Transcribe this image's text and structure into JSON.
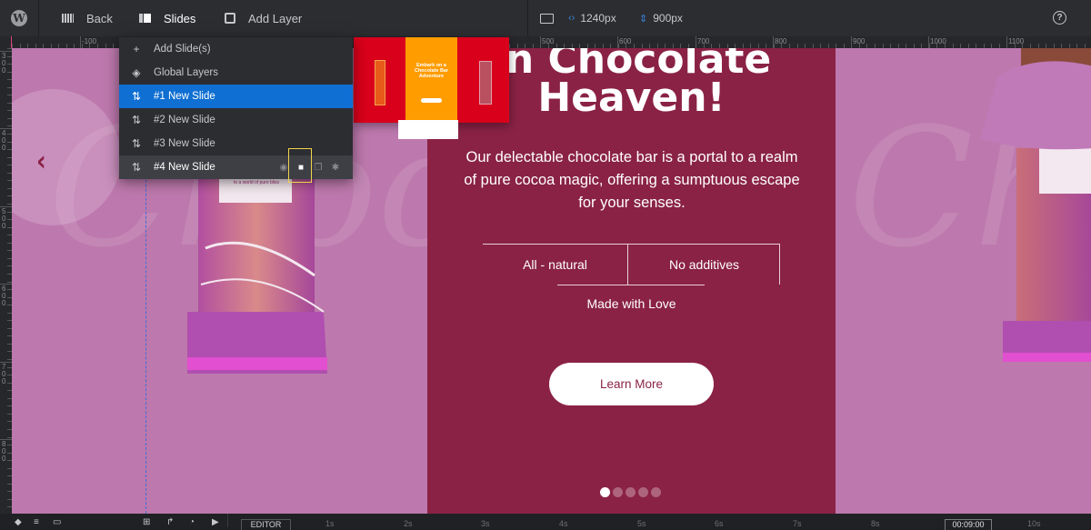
{
  "topbar": {
    "wp_icon": "wordpress-logo-icon",
    "back_label": "Back",
    "slides_label": "Slides",
    "add_layer_label": "Add Layer",
    "device_icon": "desktop-monitor-icon",
    "width_value": "1240px",
    "height_value": "900px",
    "help_icon": "help-circle-icon",
    "help_glyph": "?"
  },
  "rulers": {
    "horizontal_labels": [
      "-100",
      "500",
      "600",
      "700",
      "800",
      "900",
      "1000",
      "1100"
    ],
    "vertical_labels": [
      "300",
      "400",
      "500",
      "600",
      "700",
      "800"
    ]
  },
  "slides_menu": {
    "items": [
      {
        "label": "Add Slide(s)",
        "icon": "plus-icon",
        "glyph": "+"
      },
      {
        "label": "Global Layers",
        "icon": "layers-icon",
        "glyph": "◈"
      },
      {
        "label": "#1 New Slide",
        "icon": "sort-arrows-icon",
        "glyph": "⇅",
        "state": "selected"
      },
      {
        "label": "#2 New Slide",
        "icon": "sort-arrows-icon",
        "glyph": "⇅"
      },
      {
        "label": "#3 New Slide",
        "icon": "sort-arrows-icon",
        "glyph": "⇅"
      },
      {
        "label": "#4 New Slide",
        "icon": "sort-arrows-icon",
        "glyph": "⇅",
        "state": "hover"
      }
    ],
    "row_actions": {
      "visibility_glyph": "◉",
      "delete_glyph": "■",
      "duplicate_glyph": "❐",
      "settings_glyph": "✱"
    }
  },
  "preview": {
    "title": "Embark on a Chocolate Bar Adventure"
  },
  "slide": {
    "headline_line1": "in Chocolate",
    "headline_line2": "Heaven!",
    "paragraph": "Our delectable chocolate bar is a portal to a realm of pure cocoa magic, offering a sumptuous escape for your senses.",
    "feature_1": "All - natural",
    "feature_2": "No additives",
    "feature_3": "Made with Love",
    "cta_label": "Learn More",
    "prev_arrow": "‹",
    "script_text": "Choco",
    "dots_total": 5,
    "dots_active_index": 0,
    "wrapper_text": "to a world of pure bliss"
  },
  "bottombar": {
    "editor_label": "EDITOR",
    "time_labels": [
      "1s",
      "2s",
      "3s",
      "4s",
      "5s",
      "6s",
      "7s",
      "8s",
      "10s"
    ],
    "current_time": "00:09:00",
    "icons": [
      "layers-toggle-icon",
      "list-icon",
      "folder-icon",
      "grid-icon",
      "redo-icon",
      "stopwatch-icon",
      "play-icon"
    ]
  },
  "colors": {
    "accent_blue": "#0f6fd2",
    "panel_maroon": "#8a2245",
    "canvas_pink": "#bd79ad",
    "highlight_yellow": "#f1d44a"
  }
}
